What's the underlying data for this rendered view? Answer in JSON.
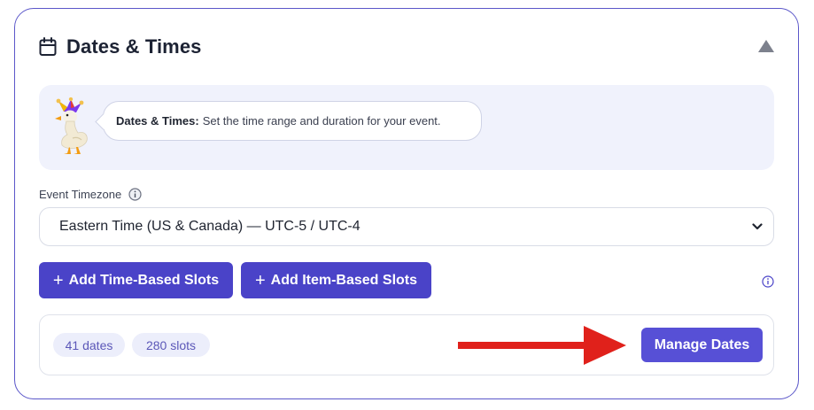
{
  "section": {
    "title": "Dates & Times",
    "icon": "calendar-icon",
    "collapse_icon": "triangle-up-icon"
  },
  "tip": {
    "bold": "Dates & Times:",
    "text": "Set the time range and duration for your event."
  },
  "timezone": {
    "label": "Event Timezone",
    "selected": "Eastern Time (US & Canada) — UTC-5 / UTC-4"
  },
  "actions": {
    "time_based": "Add Time-Based Slots",
    "item_based": "Add Item-Based Slots",
    "plus": "+"
  },
  "summary": {
    "dates": "41 dates",
    "slots": "280 slots",
    "manage": "Manage Dates"
  },
  "colors": {
    "accent": "#4a43c8",
    "card_border": "#5b57c9",
    "panel_bg": "#f0f2fc",
    "arrow": "#e0211b"
  }
}
